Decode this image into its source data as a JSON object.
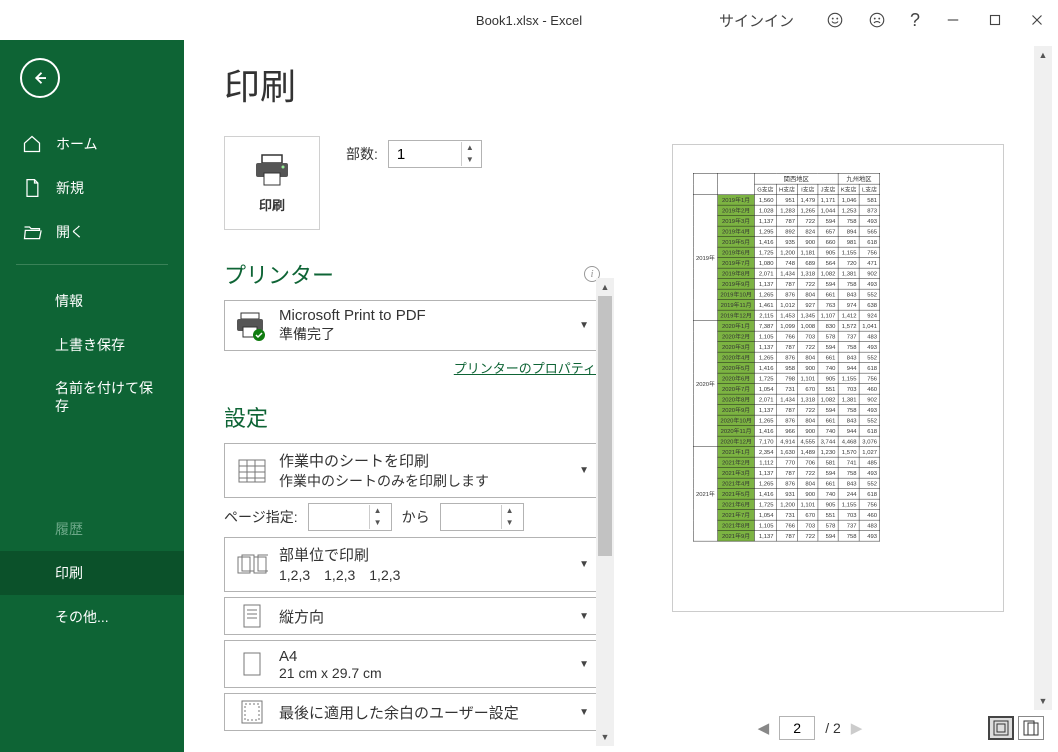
{
  "titlebar": {
    "title": "Book1.xlsx - Excel",
    "signin": "サインイン"
  },
  "sidebar": {
    "home": "ホーム",
    "new": "新規",
    "open": "開く",
    "info": "情報",
    "save": "上書き保存",
    "saveas": "名前を付けて保存",
    "history": "履歴",
    "print": "印刷",
    "other": "その他..."
  },
  "page": {
    "title": "印刷",
    "printBtn": "印刷",
    "copiesLabel": "部数:",
    "copiesValue": "1",
    "printerSection": "プリンター",
    "printerName": "Microsoft Print to PDF",
    "printerStatus": "準備完了",
    "printerProps": "プリンターのプロパティ",
    "settingsSection": "設定",
    "opt1a": "作業中のシートを印刷",
    "opt1b": "作業中のシートのみを印刷します",
    "rangeLabel": "ページ指定:",
    "rangeFrom": "",
    "rangeTo": "",
    "rangeToLabel": "から",
    "opt2a": "部単位で印刷",
    "opt2b": "1,2,3　1,2,3　1,2,3",
    "opt3a": "縦方向",
    "opt4a": "A4",
    "opt4b": "21 cm x 29.7 cm",
    "opt5a": "最後に適用した余白のユーザー設定"
  },
  "preview": {
    "regionA": "関西地区",
    "regionB": "九州地区",
    "stores": [
      "G支店",
      "H支店",
      "I支店",
      "J支店",
      "K支店",
      "L支店"
    ],
    "years": [
      "2019年",
      "2020年",
      "2021年"
    ],
    "rows": [
      {
        "y": 0,
        "m": "2019年1月",
        "v": [
          "1,560",
          "951",
          "1,479",
          "1,171",
          "1,046",
          "581"
        ]
      },
      {
        "y": 0,
        "m": "2019年2月",
        "v": [
          "1,028",
          "1,283",
          "1,265",
          "1,044",
          "1,253",
          "873"
        ]
      },
      {
        "y": 0,
        "m": "2019年3月",
        "v": [
          "1,137",
          "787",
          "722",
          "594",
          "758",
          "493"
        ]
      },
      {
        "y": 0,
        "m": "2019年4月",
        "v": [
          "1,295",
          "892",
          "824",
          "657",
          "894",
          "565"
        ]
      },
      {
        "y": 0,
        "m": "2019年5月",
        "v": [
          "1,416",
          "935",
          "900",
          "660",
          "981",
          "618"
        ]
      },
      {
        "y": 0,
        "m": "2019年6月",
        "v": [
          "1,725",
          "1,200",
          "1,181",
          "905",
          "1,155",
          "756"
        ]
      },
      {
        "y": 0,
        "m": "2019年7月",
        "v": [
          "1,080",
          "748",
          "689",
          "564",
          "720",
          "471"
        ]
      },
      {
        "y": 0,
        "m": "2019年8月",
        "v": [
          "2,071",
          "1,434",
          "1,318",
          "1,082",
          "1,381",
          "902"
        ]
      },
      {
        "y": 0,
        "m": "2019年9月",
        "v": [
          "1,137",
          "787",
          "722",
          "594",
          "758",
          "493"
        ]
      },
      {
        "y": 0,
        "m": "2019年10月",
        "v": [
          "1,265",
          "876",
          "804",
          "661",
          "843",
          "552"
        ]
      },
      {
        "y": 0,
        "m": "2019年11月",
        "v": [
          "1,461",
          "1,012",
          "927",
          "763",
          "974",
          "638"
        ]
      },
      {
        "y": 0,
        "m": "2019年12月",
        "v": [
          "2,115",
          "1,453",
          "1,345",
          "1,107",
          "1,412",
          "924"
        ]
      },
      {
        "y": 1,
        "m": "2020年1月",
        "v": [
          "7,387",
          "1,099",
          "1,008",
          "830",
          "1,572",
          "1,041"
        ]
      },
      {
        "y": 1,
        "m": "2020年2月",
        "v": [
          "1,105",
          "766",
          "703",
          "578",
          "737",
          "483"
        ]
      },
      {
        "y": 1,
        "m": "2020年3月",
        "v": [
          "1,137",
          "787",
          "722",
          "594",
          "758",
          "493"
        ]
      },
      {
        "y": 1,
        "m": "2020年4月",
        "v": [
          "1,265",
          "876",
          "804",
          "661",
          "843",
          "552"
        ]
      },
      {
        "y": 1,
        "m": "2020年5月",
        "v": [
          "1,416",
          "958",
          "900",
          "740",
          "944",
          "618"
        ]
      },
      {
        "y": 1,
        "m": "2020年6月",
        "v": [
          "1,725",
          "798",
          "1,101",
          "905",
          "1,155",
          "756"
        ]
      },
      {
        "y": 1,
        "m": "2020年7月",
        "v": [
          "1,054",
          "731",
          "670",
          "551",
          "703",
          "460"
        ]
      },
      {
        "y": 1,
        "m": "2020年8月",
        "v": [
          "2,071",
          "1,434",
          "1,318",
          "1,082",
          "1,381",
          "902"
        ]
      },
      {
        "y": 1,
        "m": "2020年9月",
        "v": [
          "1,137",
          "787",
          "722",
          "594",
          "758",
          "493"
        ]
      },
      {
        "y": 1,
        "m": "2020年10月",
        "v": [
          "1,265",
          "876",
          "804",
          "661",
          "843",
          "552"
        ]
      },
      {
        "y": 1,
        "m": "2020年11月",
        "v": [
          "1,416",
          "966",
          "900",
          "740",
          "944",
          "618"
        ]
      },
      {
        "y": 1,
        "m": "2020年12月",
        "v": [
          "7,170",
          "4,914",
          "4,555",
          "3,744",
          "4,468",
          "3,076"
        ]
      },
      {
        "y": 2,
        "m": "2021年1月",
        "v": [
          "2,354",
          "1,630",
          "1,489",
          "1,230",
          "1,570",
          "1,027"
        ]
      },
      {
        "y": 2,
        "m": "2021年2月",
        "v": [
          "1,112",
          "770",
          "706",
          "581",
          "741",
          "485"
        ]
      },
      {
        "y": 2,
        "m": "2021年3月",
        "v": [
          "1,137",
          "787",
          "722",
          "594",
          "758",
          "493"
        ]
      },
      {
        "y": 2,
        "m": "2021年4月",
        "v": [
          "1,265",
          "876",
          "804",
          "661",
          "843",
          "552"
        ]
      },
      {
        "y": 2,
        "m": "2021年5月",
        "v": [
          "1,416",
          "931",
          "900",
          "740",
          "244",
          "618"
        ]
      },
      {
        "y": 2,
        "m": "2021年6月",
        "v": [
          "1,725",
          "1,200",
          "1,101",
          "905",
          "1,155",
          "756"
        ]
      },
      {
        "y": 2,
        "m": "2021年7月",
        "v": [
          "1,054",
          "731",
          "670",
          "551",
          "703",
          "460"
        ]
      },
      {
        "y": 2,
        "m": "2021年8月",
        "v": [
          "1,105",
          "766",
          "703",
          "578",
          "737",
          "483"
        ]
      },
      {
        "y": 2,
        "m": "2021年9月",
        "v": [
          "1,137",
          "787",
          "722",
          "594",
          "758",
          "493"
        ]
      }
    ]
  },
  "paginator": {
    "current": "2",
    "total": "/ 2"
  }
}
